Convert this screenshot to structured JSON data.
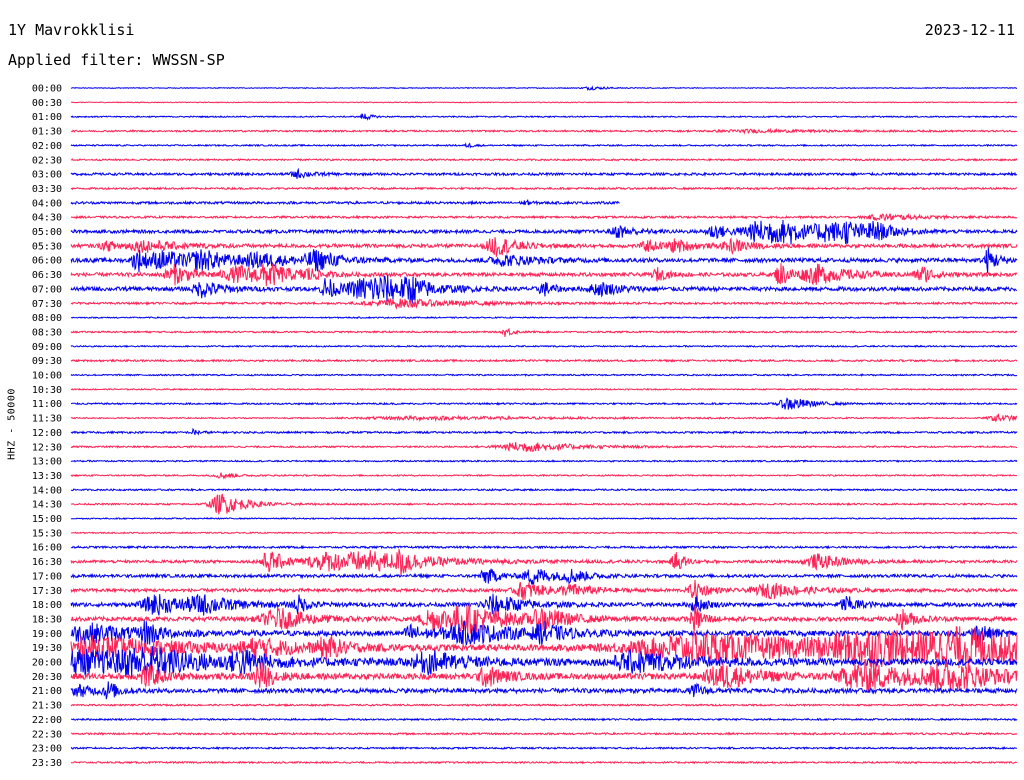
{
  "header": {
    "station": "1Y Mavrokklisi",
    "date": "2023-12-11",
    "filter": "Applied filter: WWSSN-SP"
  },
  "chart_data": {
    "type": "line",
    "title": "1Y Mavrokklisi",
    "ylabel": "HHZ - 50000",
    "colors": [
      "#0000ee",
      "#ff2255"
    ],
    "xlim_minutes": [
      0,
      30
    ],
    "grid": false,
    "row_labels": [
      "00:00",
      "00:30",
      "01:00",
      "01:30",
      "02:00",
      "02:30",
      "03:00",
      "03:30",
      "04:00",
      "04:30",
      "05:00",
      "05:30",
      "06:00",
      "06:30",
      "07:00",
      "07:30",
      "08:00",
      "08:30",
      "09:00",
      "09:30",
      "10:00",
      "10:30",
      "11:00",
      "11:30",
      "12:00",
      "12:30",
      "13:00",
      "13:30",
      "14:00",
      "14:30",
      "15:00",
      "15:30",
      "16:00",
      "16:30",
      "17:00",
      "17:30",
      "18:00",
      "18:30",
      "19:00",
      "19:30",
      "20:00",
      "20:30",
      "21:00",
      "21:30",
      "22:00",
      "22:30",
      "23:00",
      "23:30"
    ],
    "trace_extent": [
      1,
      1,
      1,
      1,
      1,
      1,
      1,
      1,
      0.58,
      1,
      1,
      1,
      1,
      1,
      1,
      1,
      1,
      1,
      1,
      1,
      1,
      1,
      1,
      1,
      1,
      1,
      1,
      1,
      1,
      1,
      1,
      1,
      1,
      1,
      1,
      1,
      1,
      1,
      1,
      1,
      1,
      1,
      1,
      1,
      1,
      1,
      1,
      1
    ],
    "noise_level": [
      0.4,
      0.4,
      0.6,
      0.8,
      0.7,
      0.8,
      1.2,
      0.9,
      1.2,
      1.0,
      1.6,
      1.8,
      2.0,
      1.8,
      2.0,
      1.0,
      0.6,
      0.8,
      0.7,
      0.9,
      0.7,
      0.6,
      0.8,
      0.6,
      0.9,
      0.8,
      0.7,
      0.7,
      0.8,
      0.8,
      0.6,
      0.6,
      1.0,
      1.4,
      1.5,
      1.6,
      2.0,
      2.2,
      2.6,
      3.2,
      3.4,
      3.0,
      2.2,
      0.8,
      0.8,
      0.9,
      0.8,
      0.8
    ],
    "events": [
      [
        [
          0.55,
          1.6,
          0.01
        ]
      ],
      [],
      [
        [
          0.31,
          4,
          0.004
        ]
      ],
      [
        [
          0.72,
          1.2,
          0.04
        ]
      ],
      [
        [
          0.42,
          2,
          0.004
        ]
      ],
      [],
      [
        [
          0.24,
          4,
          0.008
        ]
      ],
      [],
      [
        [
          0.48,
          2,
          0.004
        ]
      ],
      [
        [
          0.86,
          3,
          0.02
        ]
      ],
      [
        [
          0.58,
          6,
          0.01
        ],
        [
          0.68,
          7,
          0.01
        ],
        [
          0.72,
          8,
          0.012
        ],
        [
          0.74,
          9,
          0.016
        ],
        [
          0.76,
          8,
          0.01
        ],
        [
          0.8,
          8,
          0.016
        ],
        [
          0.82,
          7,
          0.012
        ],
        [
          0.85,
          7,
          0.012
        ]
      ],
      [
        [
          0.04,
          4,
          0.01
        ],
        [
          0.08,
          5,
          0.02
        ],
        [
          0.45,
          10,
          0.012
        ],
        [
          0.61,
          5,
          0.008
        ],
        [
          0.64,
          6,
          0.01
        ],
        [
          0.7,
          6,
          0.012
        ]
      ],
      [
        [
          0.07,
          12,
          0.006
        ],
        [
          0.1,
          8,
          0.02
        ],
        [
          0.14,
          8,
          0.016
        ],
        [
          0.2,
          6,
          0.02
        ],
        [
          0.26,
          9,
          0.014
        ],
        [
          0.46,
          5,
          0.02
        ],
        [
          0.97,
          12,
          0.006
        ]
      ],
      [
        [
          0.11,
          9,
          0.012
        ],
        [
          0.18,
          8,
          0.02
        ],
        [
          0.21,
          9,
          0.012
        ],
        [
          0.25,
          6,
          0.006
        ],
        [
          0.62,
          6,
          0.006
        ],
        [
          0.75,
          12,
          0.006
        ],
        [
          0.79,
          9,
          0.02
        ],
        [
          0.9,
          8,
          0.008
        ]
      ],
      [
        [
          0.14,
          8,
          0.012
        ],
        [
          0.27,
          12,
          0.006
        ],
        [
          0.31,
          9,
          0.02
        ],
        [
          0.33,
          9,
          0.02
        ],
        [
          0.36,
          8,
          0.01
        ],
        [
          0.5,
          7,
          0.006
        ],
        [
          0.56,
          6,
          0.014
        ]
      ],
      [
        [
          0.35,
          4,
          0.04
        ]
      ],
      [],
      [
        [
          0.46,
          5,
          0.004
        ]
      ],
      [],
      [],
      [],
      [],
      [
        [
          0.76,
          7,
          0.012
        ]
      ],
      [
        [
          0.38,
          1.6,
          0.08
        ],
        [
          0.98,
          4,
          0.01
        ]
      ],
      [
        [
          0.13,
          3,
          0.004
        ]
      ],
      [
        [
          0.48,
          5,
          0.03
        ]
      ],
      [],
      [
        [
          0.16,
          3,
          0.008
        ]
      ],
      [],
      [
        [
          0.16,
          11,
          0.014
        ]
      ],
      [],
      [],
      [],
      [
        [
          0.21,
          10,
          0.012
        ],
        [
          0.27,
          8,
          0.02
        ],
        [
          0.32,
          8,
          0.04
        ],
        [
          0.35,
          10,
          0.006
        ],
        [
          0.64,
          9,
          0.006
        ],
        [
          0.79,
          7,
          0.016
        ]
      ],
      [
        [
          0.44,
          8,
          0.008
        ],
        [
          0.49,
          9,
          0.012
        ],
        [
          0.53,
          6,
          0.01
        ]
      ],
      [
        [
          0.48,
          9,
          0.012
        ],
        [
          0.53,
          5,
          0.016
        ],
        [
          0.66,
          9,
          0.008
        ],
        [
          0.74,
          7,
          0.02
        ]
      ],
      [
        [
          0.09,
          10,
          0.016
        ],
        [
          0.14,
          8,
          0.02
        ],
        [
          0.24,
          9,
          0.006
        ],
        [
          0.45,
          10,
          0.016
        ],
        [
          0.66,
          9,
          0.006
        ],
        [
          0.82,
          8,
          0.008
        ]
      ],
      [
        [
          0.22,
          10,
          0.02
        ],
        [
          0.38,
          10,
          0.012
        ],
        [
          0.42,
          12,
          0.03
        ],
        [
          0.5,
          10,
          0.012
        ],
        [
          0.66,
          12,
          0.006
        ],
        [
          0.88,
          9,
          0.008
        ]
      ],
      [
        [
          0.02,
          9,
          0.03
        ],
        [
          0.08,
          12,
          0.006
        ],
        [
          0.36,
          8,
          0.008
        ],
        [
          0.42,
          10,
          0.03
        ],
        [
          0.5,
          8,
          0.012
        ],
        [
          0.96,
          9,
          0.008
        ]
      ],
      [
        [
          0.03,
          10,
          0.05
        ],
        [
          0.2,
          8,
          0.02
        ],
        [
          0.27,
          10,
          0.01
        ],
        [
          0.67,
          14,
          0.08
        ],
        [
          0.85,
          14,
          0.06
        ],
        [
          0.95,
          12,
          0.05
        ]
      ],
      [
        [
          0.0,
          12,
          0.06
        ],
        [
          0.08,
          10,
          0.03
        ],
        [
          0.18,
          10,
          0.012
        ],
        [
          0.38,
          10,
          0.02
        ],
        [
          0.6,
          10,
          0.03
        ]
      ],
      [
        [
          0.08,
          12,
          0.008
        ],
        [
          0.2,
          14,
          0.008
        ],
        [
          0.44,
          10,
          0.01
        ],
        [
          0.69,
          12,
          0.02
        ],
        [
          0.84,
          14,
          0.03
        ],
        [
          0.93,
          12,
          0.03
        ]
      ],
      [
        [
          0.01,
          5,
          0.01
        ],
        [
          0.04,
          8,
          0.006
        ],
        [
          0.66,
          6,
          0.006
        ]
      ],
      [],
      [],
      [],
      [],
      []
    ]
  }
}
